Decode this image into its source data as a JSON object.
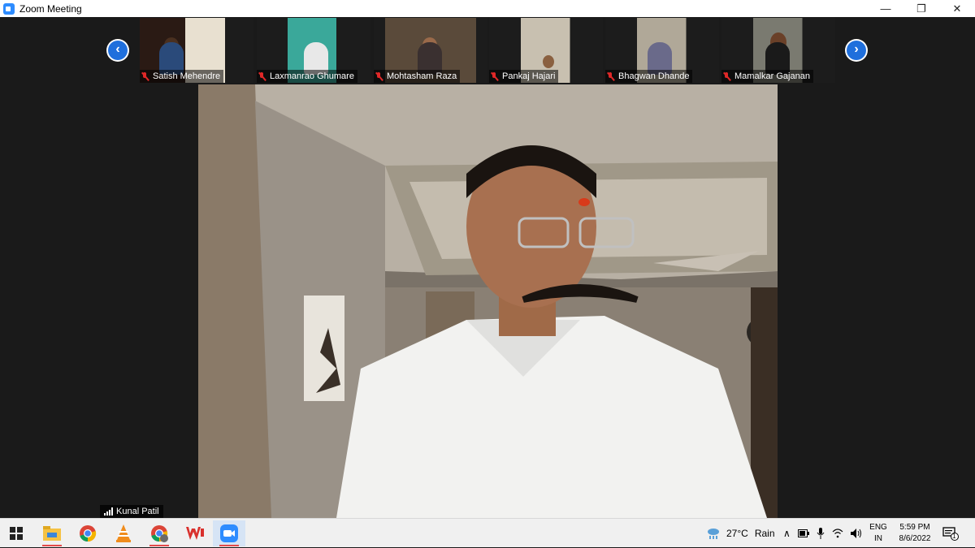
{
  "window": {
    "title": "Zoom Meeting",
    "controls": [
      "—",
      "❐",
      "✕"
    ]
  },
  "gallery": {
    "prev_icon": "chevron-left-icon",
    "next_icon": "chevron-right-icon",
    "participants": [
      {
        "name": "Satish Mehendre",
        "muted": true
      },
      {
        "name": "Laxmanrao Ghumare",
        "muted": true
      },
      {
        "name": "Mohtasham  Raza",
        "muted": true
      },
      {
        "name": "Pankaj Hajari",
        "muted": true
      },
      {
        "name": "Bhagwan Dhande",
        "muted": true
      },
      {
        "name": "Mamalkar Gajanan",
        "muted": true
      }
    ]
  },
  "active_speaker": {
    "name": "Kunal Patil"
  },
  "taskbar": {
    "apps": [
      "windows-start-icon",
      "file-explorer-icon",
      "chrome-icon",
      "vlc-icon",
      "chrome-profile-icon",
      "wps-office-icon",
      "zoom-icon"
    ],
    "weather": {
      "temp": "27°C",
      "condition": "Rain"
    },
    "language": {
      "line1": "ENG",
      "line2": "IN"
    },
    "clock": {
      "time": "5:59 PM",
      "date": "8/6/2022"
    },
    "notification_count": "1"
  },
  "colors": {
    "accent": "#2d8cff",
    "nav_button": "#1f6fdc",
    "mute_red": "#e02828"
  }
}
